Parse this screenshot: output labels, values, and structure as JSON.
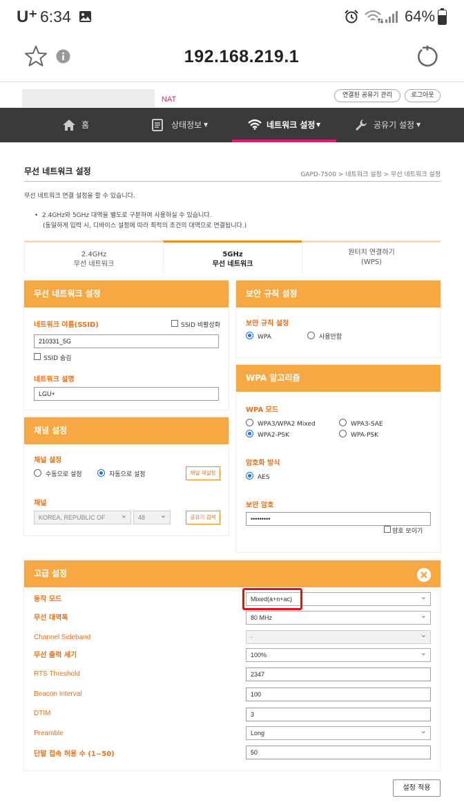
{
  "status_bar": {
    "carrier": "U⁺",
    "time": "6:34",
    "battery": "64%",
    "icons": [
      "gallery-icon",
      "alarm-icon",
      "wifi-icon",
      "signal-icon",
      "battery-icon"
    ]
  },
  "browser": {
    "url": "192.168.219.1",
    "icons": [
      "star-icon",
      "info-icon",
      "reload-icon"
    ]
  },
  "header": {
    "nat": "NAT",
    "connected_devices_btn": "연결된 공유기 관리",
    "logout_btn": "로그아웃"
  },
  "nav": {
    "items": [
      {
        "label": "홈",
        "icon": "home-icon"
      },
      {
        "label": "상태정보",
        "icon": "document-icon"
      },
      {
        "label": "네트워크 설정",
        "icon": "wifi-icon"
      },
      {
        "label": "공유기 설정",
        "icon": "wrench-icon"
      }
    ],
    "active_index": 2
  },
  "page": {
    "title": "무선 네트워크 설정",
    "breadcrumb": "GAPD-7500 > 네트워크 설정 > 무선 네트워크 설정",
    "description": "무선 네트워크 연결 설정을 할 수 있습니다.",
    "note_line1": "2.4GHz와 5GHz 대역을 별도로 구분하여 사용하실 수 있습니다.",
    "note_line2": "(동일하게 입력 시, 디바이스 설정에 따라 최적의 조건의 대역으로 연결됩니다.)"
  },
  "tabs": [
    {
      "line1": "2.4GHz",
      "line2": "무선 네트워크"
    },
    {
      "line1": "5GHz",
      "line2": "무선 네트워크"
    },
    {
      "line1": "원터치 연결하기",
      "line2": "(WPS)"
    }
  ],
  "wireless_panel": {
    "title": "무선 네트워크 설정",
    "ssid_label": "네트워크 이름(SSID)",
    "ssid_disable": "SSID 비활성화",
    "ssid_value": "210331_5G",
    "ssid_hide": "SSID 숨김",
    "desc_label": "네트워크 설명",
    "desc_value": "LGU+"
  },
  "channel_panel": {
    "title": "채널 설정",
    "setting_label": "채널 설정",
    "manual": "수동으로 설정",
    "auto": "자동으로 설정",
    "reset_btn": "채널 재설정",
    "channel_label": "채널",
    "country": "KOREA, REPUBLIC OF",
    "channel": "48",
    "search_btn": "공유기 검색"
  },
  "security_panel": {
    "title": "보안 규칙 설정",
    "rule_label": "보안 규칙 설정",
    "wpa": "WPA",
    "none": "사용안함"
  },
  "wpa_panel": {
    "title": "WPA 알고리즘",
    "mode_label": "WPA 모드",
    "opt1": "WPA3/WPA2 Mixed",
    "opt2": "WPA3-SAE",
    "opt3": "WPA2-PSK",
    "opt4": "WPA-PSK",
    "enc_label": "암호화 방식",
    "enc_value": "AES",
    "key_label": "보안 암호",
    "key_value": "•••••••••",
    "show_pw": "암호 보이기"
  },
  "advanced": {
    "title": "고급 설정",
    "rows": [
      {
        "label": "동작 모드",
        "value": "Mixed(a+n+ac)"
      },
      {
        "label": "무선 대역폭",
        "value": "80 MHz"
      },
      {
        "label": "Channel Sideband",
        "value": "-"
      },
      {
        "label": "무선 출력 세기",
        "value": "100%"
      },
      {
        "label": "RTS Threshold",
        "value": "2347"
      },
      {
        "label": "Beacon Interval",
        "value": "100"
      },
      {
        "label": "DTIM",
        "value": "3"
      },
      {
        "label": "Preamble",
        "value": "Long"
      },
      {
        "label": "단말 접속 허용 수 (1~50)",
        "value": "50"
      }
    ],
    "apply_btn": "설정 적용"
  }
}
